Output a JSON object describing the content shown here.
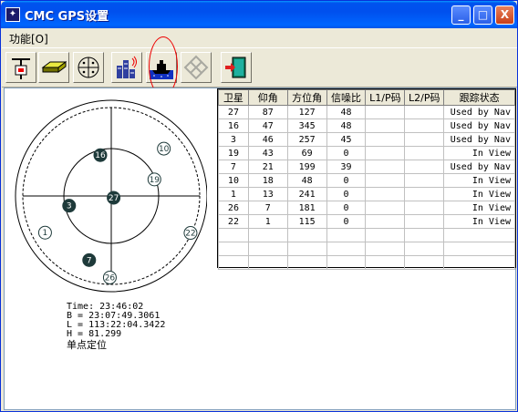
{
  "window": {
    "title": "CMC GPS设置",
    "controls": {
      "minimize": "_",
      "maximize": "□",
      "close": "X"
    }
  },
  "menu": {
    "items": [
      "功能[O]"
    ]
  },
  "toolbar": {
    "tools": [
      "antenna-icon",
      "receiver-icon",
      "compass-icon",
      "signal-tower-icon",
      "ship-icon",
      "diamond-pattern-icon",
      "exit-door-icon"
    ],
    "highlighted_index": 4
  },
  "position": {
    "time": "Time: 23:46:02",
    "b": "B = 23:07:49.3061",
    "l": "L = 113:22:04.3422",
    "h": "H = 81.299",
    "mode": "单点定位"
  },
  "skyplot": {
    "satellites": [
      {
        "id": "27",
        "elevation": 87,
        "azimuth": 127,
        "used": true
      },
      {
        "id": "16",
        "elevation": 47,
        "azimuth": 345,
        "used": true
      },
      {
        "id": "3",
        "elevation": 46,
        "azimuth": 257,
        "used": true
      },
      {
        "id": "19",
        "elevation": 43,
        "azimuth": 69,
        "used": false
      },
      {
        "id": "7",
        "elevation": 21,
        "azimuth": 199,
        "used": true
      },
      {
        "id": "10",
        "elevation": 18,
        "azimuth": 48,
        "used": false
      },
      {
        "id": "1",
        "elevation": 13,
        "azimuth": 241,
        "used": false
      },
      {
        "id": "26",
        "elevation": 7,
        "azimuth": 181,
        "used": false
      },
      {
        "id": "22",
        "elevation": 1,
        "azimuth": 115,
        "used": false
      }
    ],
    "colors": {
      "used": "#1e3a3a",
      "unused": "#ffffff",
      "unused_stroke": "#1e3a3a"
    }
  },
  "table": {
    "headers": [
      "卫星",
      "仰角",
      "方位角",
      "信噪比",
      "L1/P码",
      "L2/P码",
      "跟踪状态"
    ],
    "rows": [
      [
        "27",
        "87",
        "127",
        "48",
        "",
        "",
        "Used by Nav"
      ],
      [
        "16",
        "47",
        "345",
        "48",
        "",
        "",
        "Used by Nav"
      ],
      [
        "3",
        "46",
        "257",
        "45",
        "",
        "",
        "Used by Nav"
      ],
      [
        "19",
        "43",
        "69",
        "0",
        "",
        "",
        "In View"
      ],
      [
        "7",
        "21",
        "199",
        "39",
        "",
        "",
        "Used by Nav"
      ],
      [
        "10",
        "18",
        "48",
        "0",
        "",
        "",
        "In View"
      ],
      [
        "1",
        "13",
        "241",
        "0",
        "",
        "",
        "In View"
      ],
      [
        "26",
        "7",
        "181",
        "0",
        "",
        "",
        "In View"
      ],
      [
        "22",
        "1",
        "115",
        "0",
        "",
        "",
        "In View"
      ],
      [
        "",
        "",
        "",
        "",
        "",
        "",
        ""
      ],
      [
        "",
        "",
        "",
        "",
        "",
        "",
        ""
      ],
      [
        "",
        "",
        "",
        "",
        "",
        "",
        ""
      ]
    ]
  }
}
